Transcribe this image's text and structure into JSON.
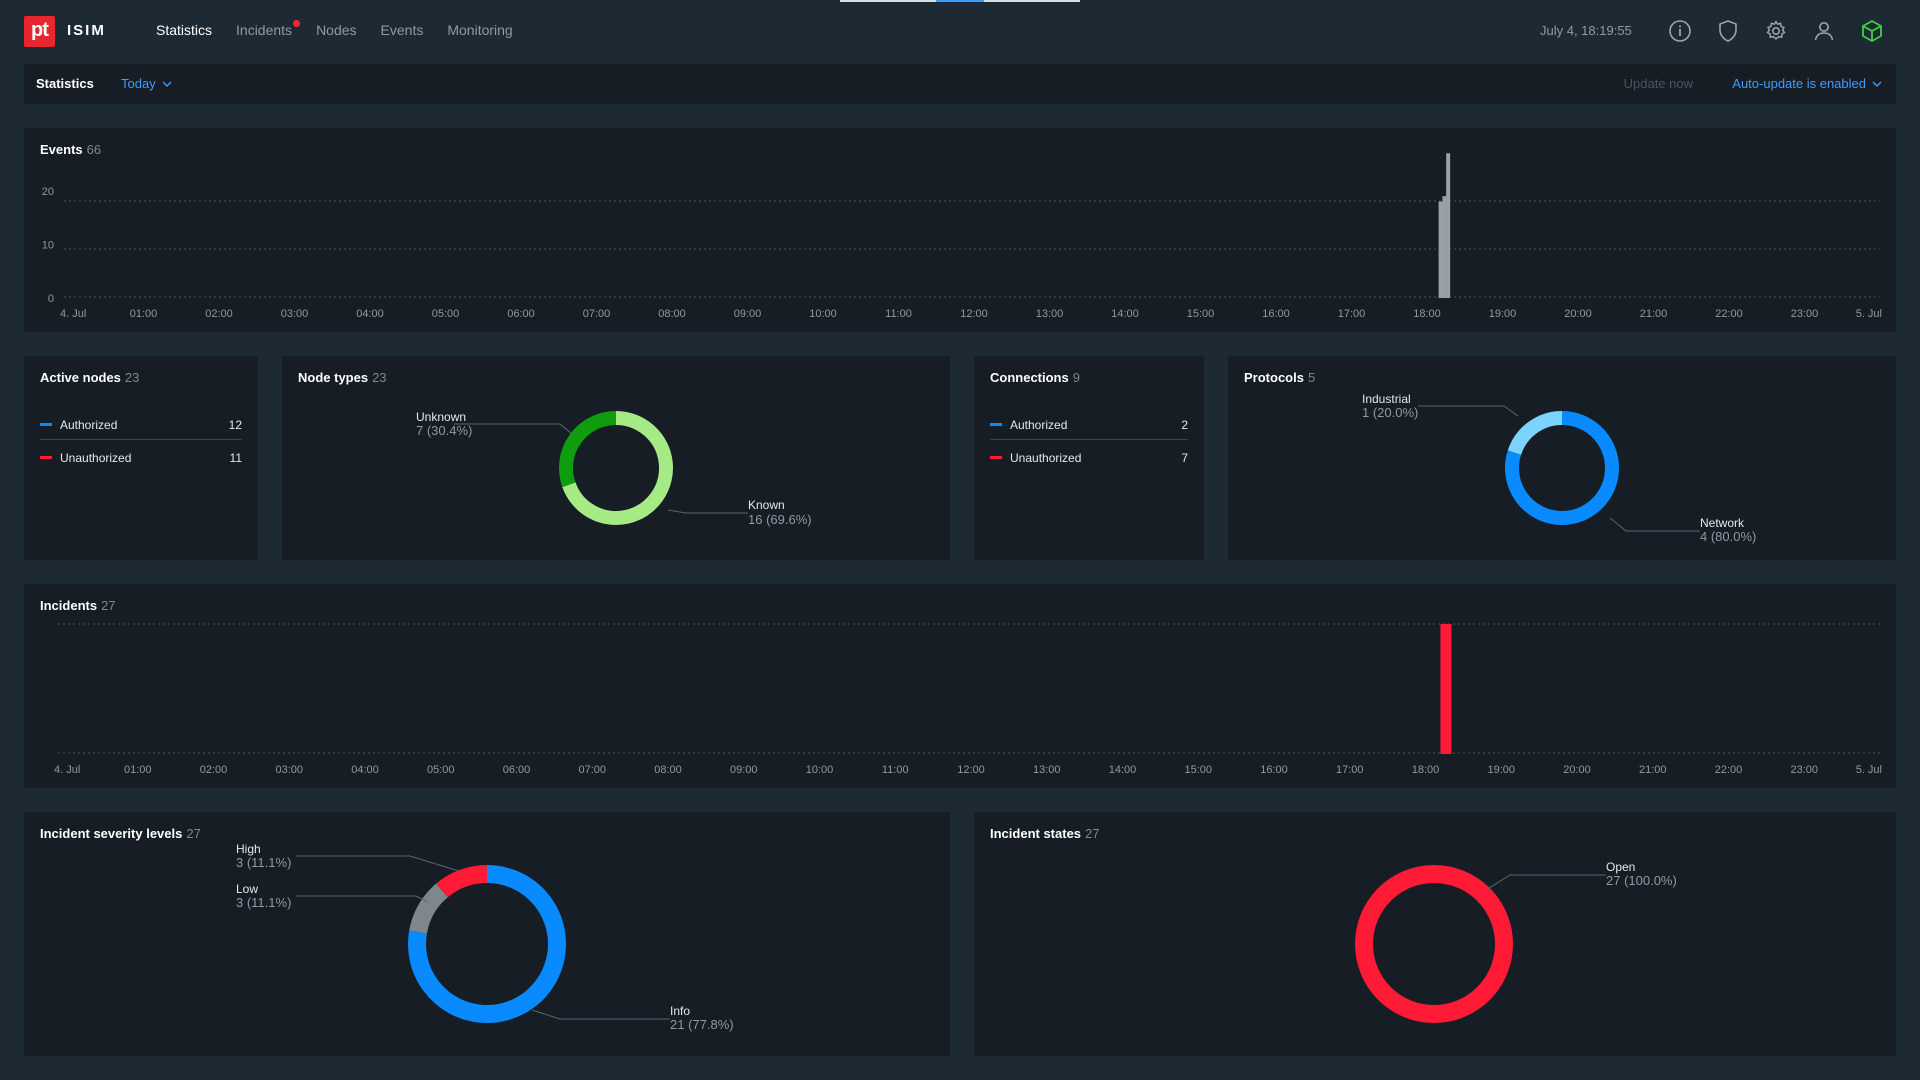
{
  "topbar": {
    "brand": "ISIM",
    "logo_text": "pt",
    "nav": [
      {
        "label": "Statistics",
        "active": true
      },
      {
        "label": "Incidents",
        "active": false,
        "badge": true
      },
      {
        "label": "Nodes",
        "active": false
      },
      {
        "label": "Events",
        "active": false
      },
      {
        "label": "Monitoring",
        "active": false
      }
    ],
    "datetime": "July 4, 18:19:55",
    "icons": [
      "info-icon",
      "shield-icon",
      "gear-icon",
      "user-icon",
      "cube-icon"
    ]
  },
  "subbar": {
    "title": "Statistics",
    "period": "Today",
    "update_now": "Update now",
    "auto_update": "Auto-update is enabled"
  },
  "colors": {
    "blue": "#0a8aff",
    "red": "#ff1a35",
    "green_dark": "#0f9d0f",
    "green_light": "#a6ea86",
    "light_blue": "#7cd3ff",
    "gray": "#7f868c",
    "bar_gray": "#9aa1a6"
  },
  "events_panel": {
    "title": "Events",
    "count": "66"
  },
  "active_nodes": {
    "title": "Active nodes",
    "count": "23",
    "rows": [
      {
        "label": "Authorized",
        "value": "12",
        "color": "#0a8aff"
      },
      {
        "label": "Unauthorized",
        "value": "11",
        "color": "#ff1a35"
      }
    ]
  },
  "node_types": {
    "title": "Node types",
    "count": "23",
    "unknown_label": "Unknown",
    "unknown_value": "7 (30.4%)",
    "known_label": "Known",
    "known_value": "16 (69.6%)"
  },
  "connections": {
    "title": "Connections",
    "count": "9",
    "rows": [
      {
        "label": "Authorized",
        "value": "2",
        "color": "#0a8aff"
      },
      {
        "label": "Unauthorized",
        "value": "7",
        "color": "#ff1a35"
      }
    ]
  },
  "protocols": {
    "title": "Protocols",
    "count": "5",
    "industrial_label": "Industrial",
    "industrial_value": "1 (20.0%)",
    "network_label": "Network",
    "network_value": "4 (80.0%)"
  },
  "incidents_panel": {
    "title": "Incidents",
    "count": "27"
  },
  "severity": {
    "title": "Incident severity levels",
    "count": "27",
    "high_label": "High",
    "high_value": "3 (11.1%)",
    "low_label": "Low",
    "low_value": "3 (11.1%)",
    "info_label": "Info",
    "info_value": "21 (77.8%)"
  },
  "states": {
    "title": "Incident states",
    "count": "27",
    "open_label": "Open",
    "open_value": "27 (100.0%)"
  },
  "chart_data": [
    {
      "type": "bar",
      "name": "events",
      "x_ticks": [
        "4. Jul",
        "01:00",
        "02:00",
        "03:00",
        "04:00",
        "05:00",
        "06:00",
        "07:00",
        "08:00",
        "09:00",
        "10:00",
        "11:00",
        "12:00",
        "13:00",
        "14:00",
        "15:00",
        "16:00",
        "17:00",
        "18:00",
        "19:00",
        "20:00",
        "21:00",
        "22:00",
        "23:00",
        "5. Jul"
      ],
      "y_ticks": [
        "0",
        "10",
        "20"
      ],
      "ylim": [
        0,
        25
      ],
      "x_hours": [
        18.18,
        18.23,
        18.28
      ],
      "values": [
        18,
        19,
        27
      ],
      "grid": true
    },
    {
      "type": "bar",
      "name": "incidents",
      "x_ticks": [
        "4. Jul",
        "01:00",
        "02:00",
        "03:00",
        "04:00",
        "05:00",
        "06:00",
        "07:00",
        "08:00",
        "09:00",
        "10:00",
        "11:00",
        "12:00",
        "13:00",
        "14:00",
        "15:00",
        "16:00",
        "17:00",
        "18:00",
        "19:00",
        "20:00",
        "21:00",
        "22:00",
        "23:00",
        "5. Jul"
      ],
      "x_hours": [
        18.27
      ],
      "values": [
        27
      ],
      "grid": true
    },
    {
      "type": "pie",
      "name": "node_types",
      "labels": [
        "Known",
        "Unknown"
      ],
      "values": [
        16,
        7
      ],
      "colors": [
        "#a6ea86",
        "#0f9d0f"
      ]
    },
    {
      "type": "pie",
      "name": "protocols",
      "labels": [
        "Network",
        "Industrial"
      ],
      "values": [
        4,
        1
      ],
      "colors": [
        "#0a8aff",
        "#7cd3ff"
      ]
    },
    {
      "type": "pie",
      "name": "severity",
      "labels": [
        "Info",
        "Low",
        "High"
      ],
      "values": [
        21,
        3,
        3
      ],
      "colors": [
        "#0a8aff",
        "#7f868c",
        "#ff1a35"
      ]
    },
    {
      "type": "pie",
      "name": "states",
      "labels": [
        "Open"
      ],
      "values": [
        27
      ],
      "colors": [
        "#ff1a35"
      ]
    }
  ]
}
